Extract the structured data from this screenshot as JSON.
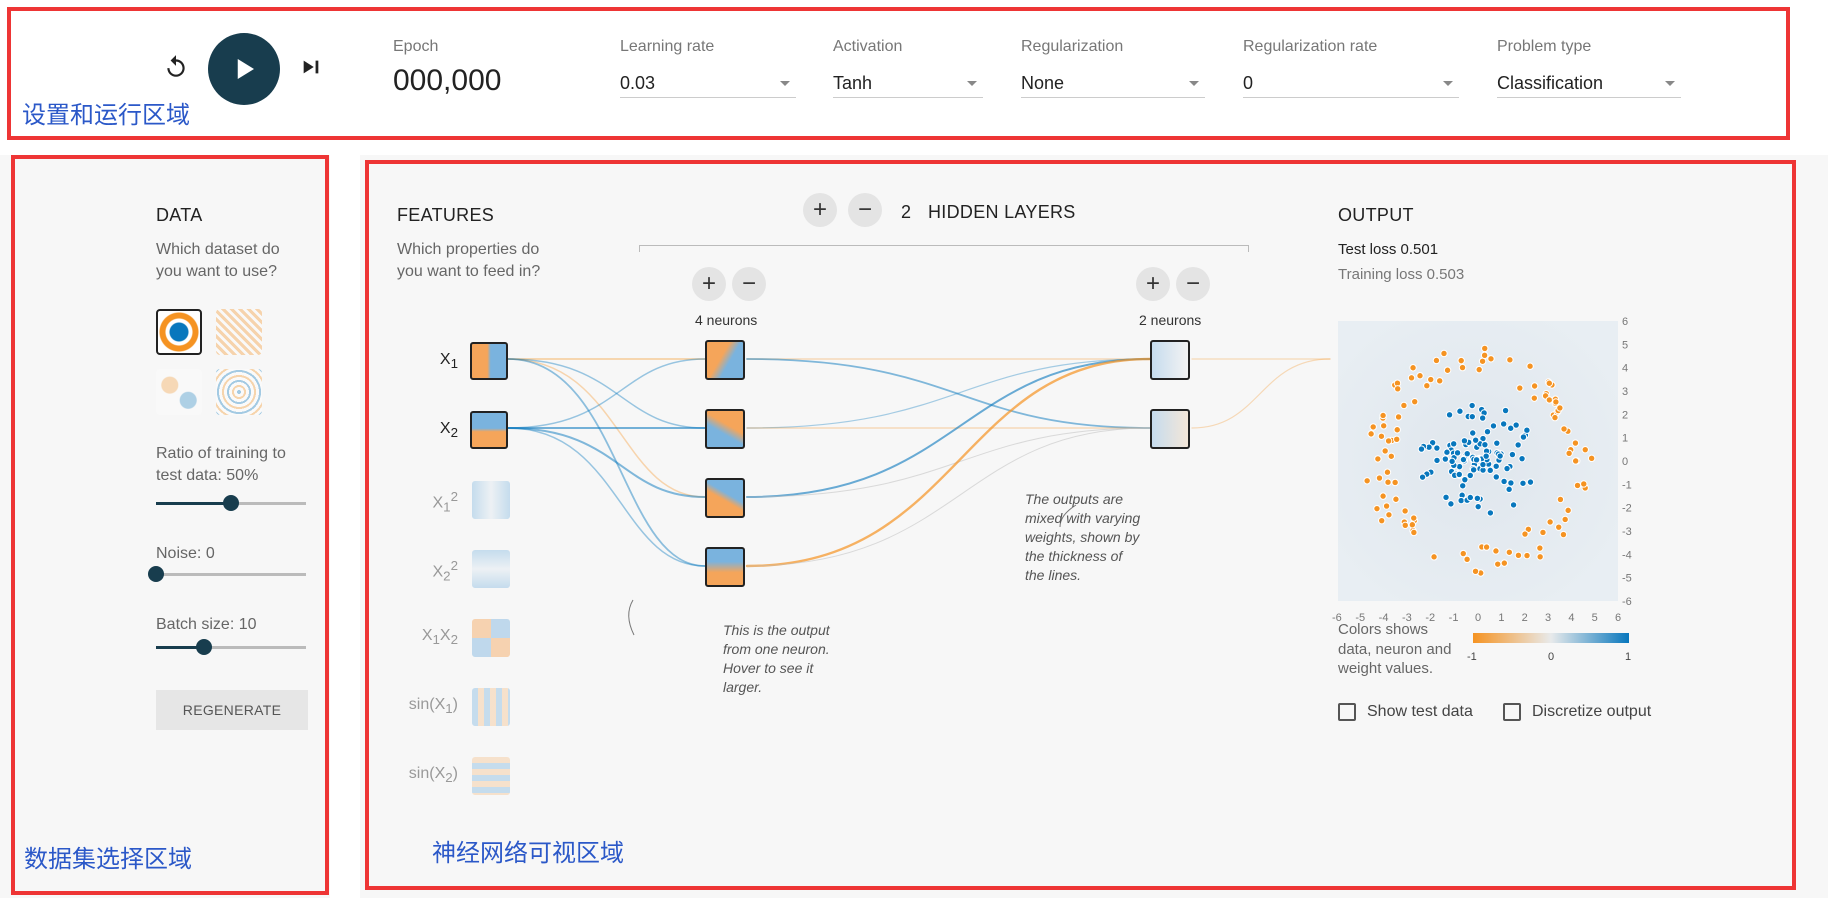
{
  "toolbar": {
    "epoch_label": "Epoch",
    "epoch_value": "000,000",
    "fields": [
      {
        "label": "Learning rate",
        "value": "0.03"
      },
      {
        "label": "Activation",
        "value": "Tanh"
      },
      {
        "label": "Regularization",
        "value": "None"
      },
      {
        "label": "Regularization rate",
        "value": "0"
      },
      {
        "label": "Problem type",
        "value": "Classification"
      }
    ]
  },
  "zones": {
    "top": "设置和运行区域",
    "left": "数据集选择区域",
    "main": "神经网络可视区域"
  },
  "data_panel": {
    "title": "DATA",
    "question": "Which dataset do you want to use?",
    "ratio_label": "Ratio of training to test data:",
    "ratio_value": "50%",
    "ratio_fraction": 0.5,
    "noise_label": "Noise:",
    "noise_value": "0",
    "noise_fraction": 0,
    "batch_label": "Batch size:",
    "batch_value": "10",
    "batch_fraction": 0.32,
    "regenerate": "REGENERATE"
  },
  "features_panel": {
    "title": "FEATURES",
    "question": "Which properties do you want to feed in?",
    "features": [
      "X1",
      "X2",
      "X1²",
      "X2²",
      "X1X2",
      "sin(X1)",
      "sin(X2)"
    ]
  },
  "network": {
    "layer_count": "2",
    "layers_label": "HIDDEN LAYERS",
    "add": "+",
    "remove": "−",
    "layer1_neurons": "4 neurons",
    "layer2_neurons": "2 neurons",
    "annotation_output": "This is the output from one neuron. Hover to see it larger.",
    "annotation_weights": "The outputs are mixed with varying weights, shown by the thickness of the lines."
  },
  "output_panel": {
    "title": "OUTPUT",
    "test_loss_label": "Test loss",
    "test_loss": "0.501",
    "train_loss_label": "Training loss",
    "train_loss": "0.503",
    "axis_ticks": [
      "-6",
      "-5",
      "-4",
      "-3",
      "-2",
      "-1",
      "0",
      "1",
      "2",
      "3",
      "4",
      "5",
      "6"
    ],
    "legend_text": "Colors shows data, neuron and weight values.",
    "legend_ticks": [
      "-1",
      "0",
      "1"
    ],
    "show_test": "Show test data",
    "discretize": "Discretize output"
  },
  "colors": {
    "orange": "#f59322",
    "blue": "#0877bd",
    "dark": "#183d4e",
    "red": "#ee3535"
  }
}
